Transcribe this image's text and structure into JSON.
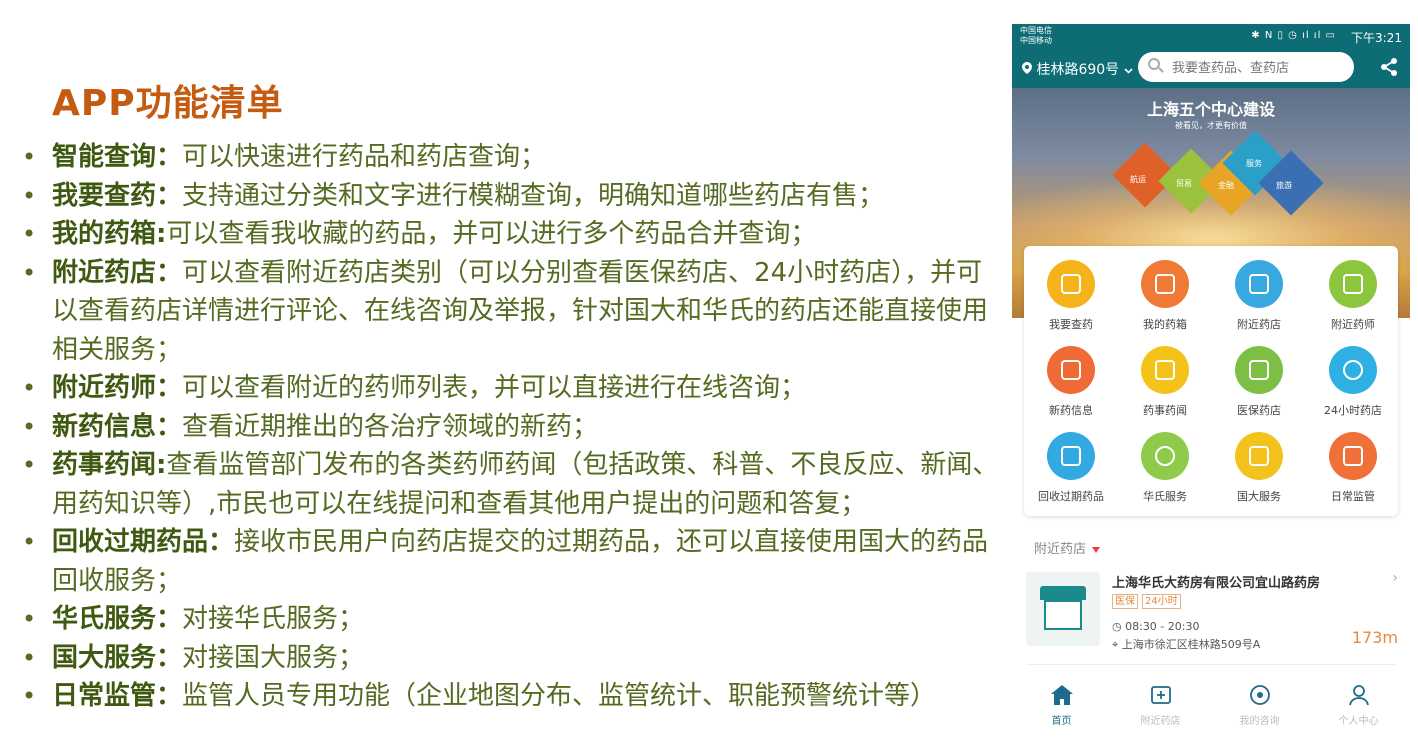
{
  "slide": {
    "title": "APP功能清单",
    "features": [
      {
        "name": "智能查询",
        "sep": "：",
        "desc": "可以快速进行药品和药店查询；"
      },
      {
        "name": "我要查药",
        "sep": "：",
        "desc": "支持通过分类和文字进行模糊查询，明确知道哪些药店有售；"
      },
      {
        "name": "我的药箱",
        "sep": ":",
        "desc": "可以查看我收藏的药品，并可以进行多个药品合并查询；"
      },
      {
        "name": "附近药店",
        "sep": "：",
        "desc": "可以查看附近药店类别（可以分别查看医保药店、24小时药店），并可以查看药店详情进行评论、在线咨询及举报，针对国大和华氏的药店还能直接使用相关服务；"
      },
      {
        "name": "附近药师",
        "sep": "：",
        "desc": "可以查看附近的药师列表，并可以直接进行在线咨询；"
      },
      {
        "name": "新药信息",
        "sep": "：",
        "desc": "查看近期推出的各治疗领域的新药；"
      },
      {
        "name": "药事药闻",
        "sep": ":",
        "desc": "查看监管部门发布的各类药师药闻（包括政策、科普、不良反应、新闻、用药知识等）,市民也可以在线提问和查看其他用户提出的问题和答复；"
      },
      {
        "name": "回收过期药品",
        "sep": "：",
        "desc": "接收市民用户向药店提交的过期药品，还可以直接使用国大的药品回收服务；"
      },
      {
        "name": "华氏服务",
        "sep": "：",
        "desc": "对接华氏服务；"
      },
      {
        "name": "国大服务",
        "sep": "：",
        "desc": "对接国大服务；"
      },
      {
        "name": "日常监管",
        "sep": "：",
        "desc": "监管人员专用功能（企业地图分布、监管统计、职能预警统计等）"
      }
    ]
  },
  "phone": {
    "status": {
      "carrier1": "中国电信",
      "carrier2": "中国移动",
      "icons": "✱ N ▯ ◷ ıl ıl ▭",
      "time": "下午3:21"
    },
    "location": "桂林路690号",
    "search_placeholder": "我要查药品、查药店",
    "banner": {
      "title": "上海五个中心建设",
      "subtitle": "被看见，才更有价值",
      "tiles": [
        "航运",
        "贸易",
        "金融",
        "服务",
        "旅游"
      ]
    },
    "grid": [
      {
        "label": "我要查药",
        "color": "#f5b21a"
      },
      {
        "label": "我的药箱",
        "color": "#f07a35"
      },
      {
        "label": "附近药店",
        "color": "#38a8e0"
      },
      {
        "label": "附近药师",
        "color": "#8cc63e"
      },
      {
        "label": "新药信息",
        "color": "#ef6a35"
      },
      {
        "label": "药事药闻",
        "color": "#f5c21a"
      },
      {
        "label": "医保药店",
        "color": "#7dbf45"
      },
      {
        "label": "24小时药店",
        "color": "#2fb0e3"
      },
      {
        "label": "回收过期药品",
        "color": "#32a9e0"
      },
      {
        "label": "华氏服务",
        "color": "#8fcb4a"
      },
      {
        "label": "国大服务",
        "color": "#f4c21c"
      },
      {
        "label": "日常监管",
        "color": "#f0703a"
      }
    ],
    "nearby_title": "附近药店",
    "store": {
      "name": "上海华氏大药房有限公司宜山路药房",
      "tags": [
        "医保",
        "24小时"
      ],
      "hours": "08:30 - 20:30",
      "address": "上海市徐汇区桂林路509号A",
      "distance": "173m"
    },
    "tabs": [
      {
        "label": "首页",
        "icon": "home-icon"
      },
      {
        "label": "附近药店",
        "icon": "pharmacy-icon"
      },
      {
        "label": "我的咨询",
        "icon": "chat-icon"
      },
      {
        "label": "个人中心",
        "icon": "user-icon"
      }
    ]
  }
}
